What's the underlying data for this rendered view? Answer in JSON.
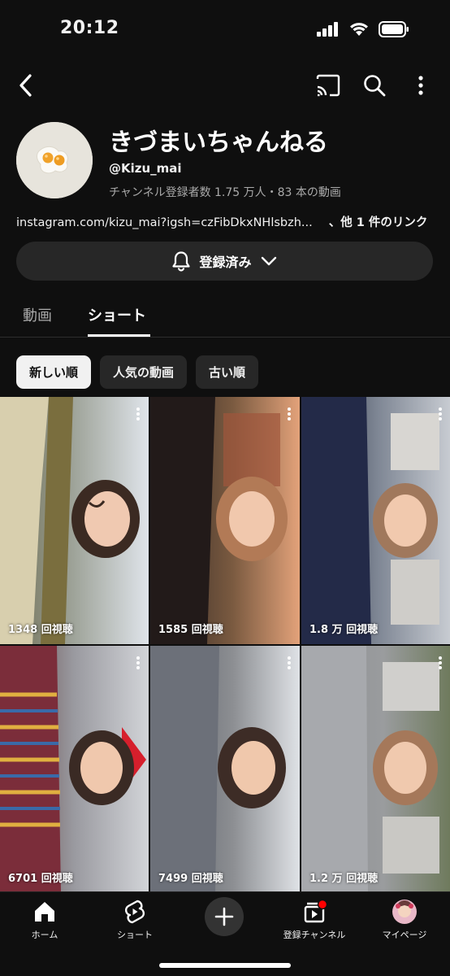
{
  "status": {
    "time": "20:12"
  },
  "channel": {
    "name": "きづまいちゃんねる",
    "handle": "@Kizu_mai",
    "stats": "チャンネル登録者数 1.75 万人・83 本の動画",
    "link": "instagram.com/kizu_mai?igsh=czFibDkxNHlsbzh...",
    "link_extra": "、他 1 件のリンク",
    "subscribe_label": "登録済み"
  },
  "tabs": [
    {
      "label": "動画"
    },
    {
      "label": "ショート",
      "active": true
    }
  ],
  "chips": [
    {
      "label": "新しい順",
      "selected": true
    },
    {
      "label": "人気の動画"
    },
    {
      "label": "古い順"
    }
  ],
  "shorts": [
    {
      "views": "1348 回視聴"
    },
    {
      "views": "1585 回視聴"
    },
    {
      "views": "1.8 万 回視聴"
    },
    {
      "views": "6701 回視聴"
    },
    {
      "views": "7499 回視聴"
    },
    {
      "views": "1.2 万 回視聴"
    }
  ],
  "bottom_nav": [
    {
      "label": "ホーム",
      "icon": "home-icon"
    },
    {
      "label": "ショート",
      "icon": "shorts-icon"
    },
    {
      "label": "",
      "icon": "create-plus-icon"
    },
    {
      "label": "登録チャンネル",
      "icon": "subscriptions-icon"
    },
    {
      "label": "マイページ",
      "icon": "profile-avatar-icon"
    }
  ],
  "colors": {
    "background": "#0f0f0f",
    "chip": "#272727",
    "notification_dot": "#ff0000"
  }
}
